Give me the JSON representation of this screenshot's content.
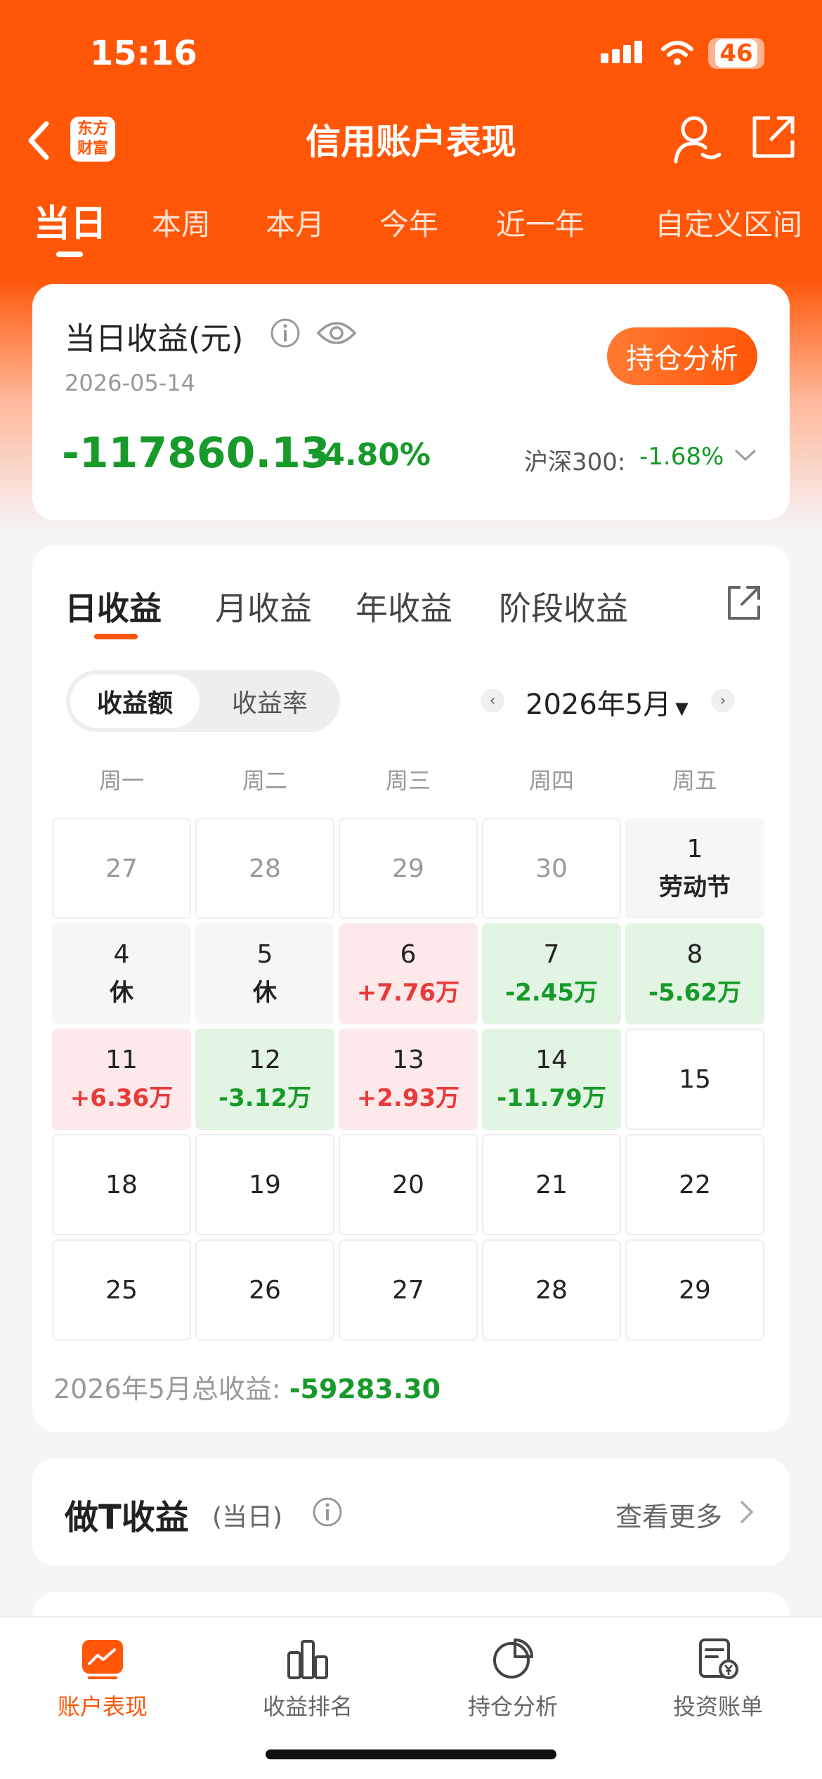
{
  "status": {
    "time": "15:16",
    "battery": "46"
  },
  "header": {
    "logo": "东方\n财富",
    "title": "信用账户表现"
  },
  "tabs": [
    "当日",
    "本周",
    "本月",
    "今年",
    "近一年",
    "自定义区间"
  ],
  "summary": {
    "label": "当日收益(元)",
    "date": "2026-05-14",
    "amount": "-117860.13",
    "pct": "-4.80%",
    "bench_label": "沪深300:",
    "bench_value": "-1.68%",
    "btn": "持仓分析"
  },
  "calendar": {
    "subtabs": [
      "日收益",
      "月收益",
      "年收益",
      "阶段收益"
    ],
    "seg": [
      "收益额",
      "收益率"
    ],
    "month": "2026年5月",
    "weekdays": [
      "周一",
      "周二",
      "周三",
      "周四",
      "周五"
    ],
    "rows": [
      [
        {
          "d": "27",
          "t": "out"
        },
        {
          "d": "28",
          "t": "out"
        },
        {
          "d": "29",
          "t": "out"
        },
        {
          "d": "30",
          "t": "out"
        },
        {
          "d": "1",
          "t": "holiday",
          "note": "劳动节"
        }
      ],
      [
        {
          "d": "4",
          "t": "holiday",
          "note": "休"
        },
        {
          "d": "5",
          "t": "holiday",
          "note": "休"
        },
        {
          "d": "6",
          "t": "pos",
          "v": "+7.76万"
        },
        {
          "d": "7",
          "t": "neg",
          "v": "-2.45万"
        },
        {
          "d": "8",
          "t": "neg",
          "v": "-5.62万"
        }
      ],
      [
        {
          "d": "11",
          "t": "pos",
          "v": "+6.36万"
        },
        {
          "d": "12",
          "t": "neg",
          "v": "-3.12万"
        },
        {
          "d": "13",
          "t": "pos",
          "v": "+2.93万"
        },
        {
          "d": "14",
          "t": "neg",
          "v": "-11.79万"
        },
        {
          "d": "15",
          "t": "plain"
        }
      ],
      [
        {
          "d": "18",
          "t": "plain"
        },
        {
          "d": "19",
          "t": "plain"
        },
        {
          "d": "20",
          "t": "plain"
        },
        {
          "d": "21",
          "t": "plain"
        },
        {
          "d": "22",
          "t": "plain"
        }
      ],
      [
        {
          "d": "25",
          "t": "plain"
        },
        {
          "d": "26",
          "t": "plain"
        },
        {
          "d": "27",
          "t": "plain"
        },
        {
          "d": "28",
          "t": "plain"
        },
        {
          "d": "29",
          "t": "plain"
        }
      ]
    ],
    "total_label": "2026年5月总收益:",
    "total_value": "-59283.30"
  },
  "t_profit": {
    "title": "做T收益",
    "sub": "(当日)",
    "more": "查看更多"
  },
  "bottom_nav": [
    "账户表现",
    "收益排名",
    "持仓分析",
    "投资账单"
  ],
  "colors": {
    "brand": "#ff5608",
    "gain": "#e83b3b",
    "loss": "#179a2a"
  }
}
